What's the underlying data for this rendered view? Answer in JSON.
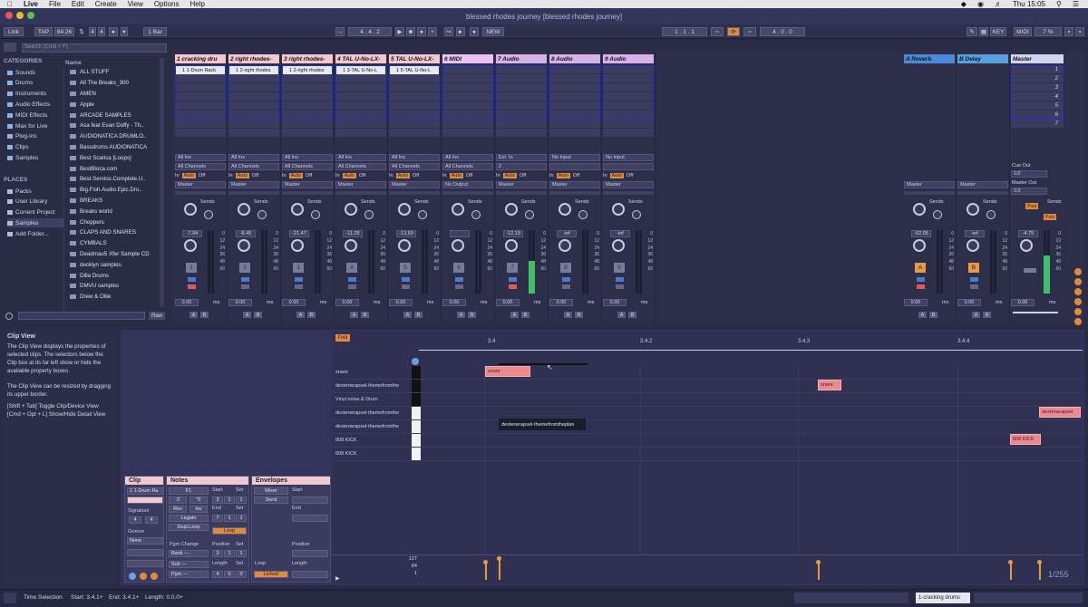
{
  "menubar": {
    "app": "Live",
    "menus": [
      "File",
      "Edit",
      "Create",
      "View",
      "Options",
      "Help"
    ],
    "clock": "Thu 15:05"
  },
  "window": {
    "title": "blessed rhodes journey  [blessed rhodes journey]"
  },
  "transport": {
    "link": "Link",
    "tap": "TAP",
    "tempo": "84.26",
    "sig_num": "4",
    "sig_den": "4",
    "quantize": "1 Bar",
    "arrangement_pos": "4 .  4 .  2",
    "new_button": "NEW",
    "loop_start": "1 .  1 .  1",
    "loop_length": "4 .  0 .  0",
    "key": "KEY",
    "midi": "MIDI",
    "cpu": "7 %",
    "colors": {
      "accent": "#e08a3c",
      "panel": "#2e2f4c"
    }
  },
  "browser": {
    "search_placeholder": "Search (Cmd + F)",
    "categories_title": "CATEGORIES",
    "categories": [
      "Sounds",
      "Drums",
      "Instruments",
      "Audio Effects",
      "MIDI Effects",
      "Max for Live",
      "Plug-ins",
      "Clips",
      "Samples"
    ],
    "places_title": "PLACES",
    "places": [
      "Packs",
      "User Library",
      "Current Project",
      "Samples",
      "Add Folder..."
    ],
    "name_header": "Name",
    "items": [
      "ALL STUFF",
      "All The Breaks_300",
      "AMEN",
      "Apple",
      "ARCADE SAMPLES",
      "Asa feat Evan Duffy - Th..",
      "AUDIONATICA DRUMLO..",
      "Bassdrums AUDIONATICA",
      "Best Scarica [Loops]",
      "BestBloca.com",
      "Best.Service.Complete.U..",
      "Big.Fish.Audio.Epic.Dru..",
      "BREAKS",
      "Breaks world",
      "Choppers",
      "CLAPS AND SNARES",
      "CYMBALS",
      "Deadmau5 Xfer Sample CD",
      "decklyn samples",
      "Dilla Drums",
      "DMVU samples",
      "Drew & Ollie"
    ],
    "raw": "Raw"
  },
  "tracks": [
    {
      "name": "1 cracking dru",
      "color": "#f2c7cf",
      "clip": "1 1-Drum Rack",
      "input": "All Ins",
      "channel": "All Channels",
      "out": "Master",
      "vol": "-7.94",
      "num": "1",
      "pan": "0.00"
    },
    {
      "name": "2 right rhodes-",
      "color": "#f2c7cf",
      "clip": "1 2-right rhodes",
      "input": "All Ins",
      "channel": "All Channels",
      "out": "Master",
      "vol": "-8.45",
      "num": "2",
      "pan": "0.00"
    },
    {
      "name": "3 right rhodes-",
      "color": "#f2c7cf",
      "clip": "1 2-right rhodes",
      "input": "All Ins",
      "channel": "All Channels",
      "out": "Master",
      "vol": "-21.47",
      "num": "3",
      "pan": "0.00"
    },
    {
      "name": "4 TAL U-No-LX-",
      "color": "#f2c7cf",
      "clip": "1 3-TAL U-No-L",
      "input": "All Ins",
      "channel": "All Channels",
      "out": "Master",
      "vol": "-11.29",
      "num": "4",
      "pan": "0.00"
    },
    {
      "name": "5 TAL U-No-LX-",
      "color": "#f2c7cf",
      "clip": "1 5-TAL U-No-L",
      "input": "All Ins",
      "channel": "All Channels",
      "out": "Master",
      "vol": "-13.59",
      "num": "5",
      "pan": "0.00"
    },
    {
      "name": "6 MIDI",
      "color": "#e9c4f0",
      "clip": "",
      "input": "All Ins",
      "channel": "All Channels",
      "out": "No Output",
      "vol": "",
      "num": "6",
      "pan": "0.00"
    },
    {
      "name": "7 Audio",
      "color": "#d6b2e8",
      "clip": "",
      "input": "Ext. In",
      "channel": "2",
      "out": "Master",
      "vol": "-12.19",
      "num": "7",
      "pan": "0.00"
    },
    {
      "name": "8 Audio",
      "color": "#d6b2e8",
      "clip": "",
      "input": "No Input",
      "channel": "",
      "out": "Master",
      "vol": "-inf",
      "num": "8",
      "pan": "0.00"
    },
    {
      "name": "9 Audio",
      "color": "#d6b2e8",
      "clip": "",
      "input": "No Input",
      "channel": "",
      "out": "Master",
      "vol": "-inf",
      "num": "9",
      "pan": "0.00"
    }
  ],
  "returns": [
    {
      "name": "A Reverb",
      "color": "#4a8ad8",
      "out": "Master",
      "vol": "-62.05",
      "num": "A",
      "pan": "0.00"
    },
    {
      "name": "B Delay",
      "color": "#5aa0e0",
      "out": "Master",
      "vol": "-inf",
      "num": "B",
      "pan": "0.00"
    }
  ],
  "master": {
    "name": "Master",
    "scenes": [
      "1",
      "2",
      "3",
      "4",
      "5",
      "6",
      "7"
    ],
    "cue_out_label": "Cue Out",
    "cue_out": "1/2",
    "master_out_label": "Master Out",
    "master_out": "1/2",
    "vol": "-4.75",
    "pan": "0.00"
  },
  "mixer_labels": {
    "sends": "Sends",
    "in": "In",
    "auto": "Auto",
    "off": "Off",
    "ms": "ms",
    "scale": [
      "0",
      "12",
      "24",
      "36",
      "48",
      "60"
    ],
    "a": "A",
    "b": "B",
    "post": "Post",
    "auto_counter": "16"
  },
  "info_view": {
    "title": "Clip View",
    "body1": "The Clip View displays the properties of selected clips. The selectors below the Clip box at its far left show or hide the available property boxes.",
    "body2": "The Clip View can be resized by dragging its upper border.",
    "body3": "[Shift + Tab] Toggle Clip/Device View [Cmd + Opt + L] Show/Hide Detail View"
  },
  "clip_panel": {
    "title": "Clip",
    "name": "1 1-Drum Ra",
    "signature_label": "Signature",
    "sig_num": "4",
    "sig_den": "4",
    "groove_label": "Groove",
    "groove": "None"
  },
  "notes_panel": {
    "title": "Notes",
    "key": "F1",
    "start_label": "Start",
    "set_label": "Set",
    "start": [
      "3",
      "1",
      "1"
    ],
    "end_label": "End",
    "end": [
      "7",
      "1",
      "1"
    ],
    "half": ":2",
    "double": "*2",
    "rev": "Rev",
    "inv": "Inv",
    "legato": "Legato",
    "dupl": "Dupl.Loop",
    "loop_btn": "Loop",
    "pgm_change": "Pgm Change",
    "bank": "Bank ---",
    "sub": "Sub ---",
    "pgm": "Pgm ---",
    "position_label": "Position",
    "position": [
      "3",
      "1",
      "1"
    ],
    "length_label": "Length",
    "length": [
      "4",
      "0",
      "0"
    ]
  },
  "env_panel": {
    "title": "Envelopes",
    "mixer": "Mixer",
    "send": "Send",
    "start_label": "Start",
    "end_label": "End",
    "position_label": "Position",
    "loop_label": "Loop",
    "length_label": "Length",
    "linked": "Linked"
  },
  "editor": {
    "fold": "Fold",
    "ruler": [
      "3.4",
      "3.4.2",
      "3.4.3",
      "3.4.4"
    ],
    "lanes": [
      "snare",
      "dexterwrapsel-themefromthe",
      "Vinyl noise & Drum",
      "dexterwrapsel-themefromthe",
      "dexterwrapsel-themefromthe",
      "808 KICK",
      "808 KICK"
    ],
    "tooltip": "dexterwrapsel-themefromtheplan",
    "notes": [
      {
        "label": "snare",
        "lane": 0
      },
      {
        "label": "snare",
        "lane": 1
      },
      {
        "label": "dexterwrapsel",
        "lane": 3
      },
      {
        "label": "808 KICK",
        "lane": 5
      }
    ],
    "vel_labels": [
      "127",
      "64",
      "1"
    ],
    "page": "1/255",
    "note_color": "#ea8a8f",
    "velocity_color": "#e79a46"
  },
  "status": {
    "time_selection": "Time Selection",
    "start": "Start: 3.4.1+",
    "end": "End: 3.4.1+",
    "length": "Length: 0.0.0+",
    "track": "1-cracking drums"
  }
}
